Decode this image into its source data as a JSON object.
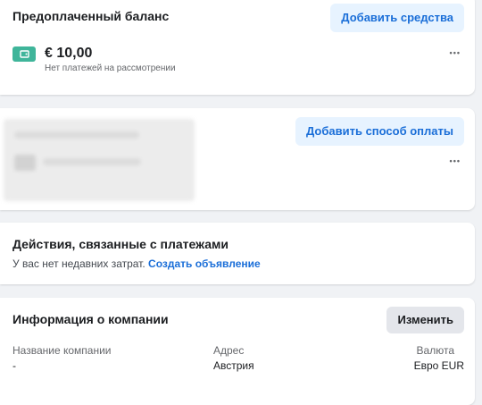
{
  "balance": {
    "title": "Предоплаченный баланс",
    "add_funds_label": "Добавить средства",
    "amount": "€ 10,00",
    "status": "Нет платежей на рассмотрении",
    "more_label": "•••"
  },
  "payment_method": {
    "add_method_label": "Добавить способ оплаты",
    "more_label": "•••"
  },
  "activity": {
    "title": "Действия, связанные с платежами",
    "text": "У вас нет недавних затрат.",
    "link": "Создать объявление"
  },
  "company": {
    "title": "Информация о компании",
    "edit_label": "Изменить",
    "columns": [
      {
        "header": "Название компании",
        "value": "-"
      },
      {
        "header": "Адрес",
        "value": "Австрия"
      },
      {
        "header": "Валюта",
        "value": "Евро EUR"
      }
    ]
  },
  "colors": {
    "accent": "#1a6ed8",
    "wallet_icon": "#3fb59a",
    "background": "#f0f2f5"
  }
}
